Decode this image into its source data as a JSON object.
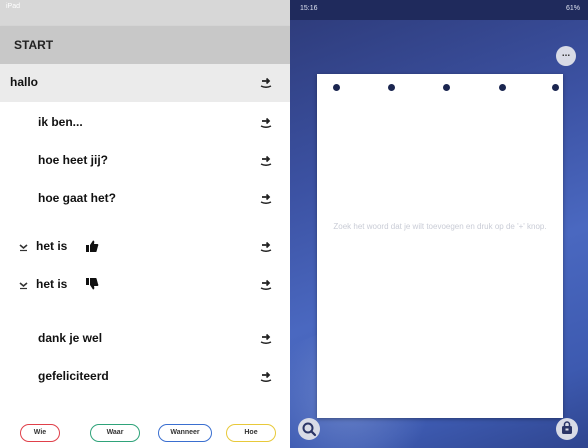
{
  "statusbar_left": {
    "carrier": "iPad"
  },
  "statusbar_right": {
    "time": "15:16",
    "battery": "61%"
  },
  "start": {
    "label": "START"
  },
  "phrases": [
    {
      "text": "hallo",
      "selected": true,
      "chevron": false,
      "thumb": ""
    },
    {
      "text": "ik ben...",
      "selected": false,
      "chevron": false,
      "thumb": ""
    },
    {
      "text": "hoe heet jij?",
      "selected": false,
      "chevron": false,
      "thumb": ""
    },
    {
      "text": "hoe gaat het?",
      "selected": false,
      "chevron": false,
      "thumb": ""
    },
    {
      "text": "het is",
      "selected": false,
      "chevron": true,
      "thumb": "thumbs-up-icon"
    },
    {
      "text": "het is",
      "selected": false,
      "chevron": true,
      "thumb": "thumbs-down-icon"
    },
    {
      "text": "dank je wel",
      "selected": false,
      "chevron": false,
      "thumb": ""
    },
    {
      "text": "gefeliciteerd",
      "selected": false,
      "chevron": false,
      "thumb": ""
    }
  ],
  "filters": [
    {
      "label": "Wie",
      "color": "#e0404a"
    },
    {
      "label": "Waar",
      "color": "#2fa37a"
    },
    {
      "label": "Wanneer",
      "color": "#3a6fd0"
    },
    {
      "label": "Hoe",
      "color": "#e8c93a"
    }
  ],
  "card": {
    "hint": "Zoek het woord dat je wilt toevoegen en druk op de '+' knop.",
    "dot_count": 5
  },
  "buttons": {
    "more": "...",
    "search_icon": "search-icon",
    "bag_icon": "bag-icon"
  },
  "colors": {
    "accent_dark": "#1b2650",
    "background_blue": "#3c52a3"
  }
}
